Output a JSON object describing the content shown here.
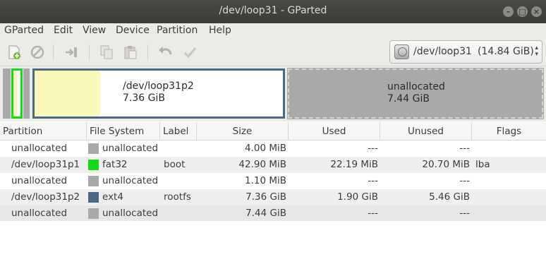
{
  "window": {
    "title": "/dev/loop31 - GParted"
  },
  "menu": {
    "items": [
      "GParted",
      "Edit",
      "View",
      "Device",
      "Partition",
      "Help"
    ]
  },
  "toolbar": {
    "device_path": "/dev/loop31",
    "device_size": "(14.84 GiB)"
  },
  "map": {
    "p2_name": "/dev/loop31p2",
    "p2_size": "7.36 GiB",
    "unalloc_name": "unallocated",
    "unalloc_size": "7.44 GiB"
  },
  "table": {
    "headers": [
      "Partition",
      "File System",
      "Label",
      "Size",
      "Used",
      "Unused",
      "Flags"
    ],
    "rows": [
      {
        "partition": "unallocated",
        "fs": "unallocated",
        "fs_color": "#a9a9a9",
        "label": "",
        "size": "4.00 MiB",
        "used": "---",
        "unused": "---",
        "flags": ""
      },
      {
        "partition": "/dev/loop31p1",
        "fs": "fat32",
        "fs_color": "#18d918",
        "label": "boot",
        "size": "42.90 MiB",
        "used": "22.19 MiB",
        "unused": "20.70 MiB",
        "flags": "lba"
      },
      {
        "partition": "unallocated",
        "fs": "unallocated",
        "fs_color": "#a9a9a9",
        "label": "",
        "size": "1.10 MiB",
        "used": "---",
        "unused": "---",
        "flags": ""
      },
      {
        "partition": "/dev/loop31p2",
        "fs": "ext4",
        "fs_color": "#4b6983",
        "label": "rootfs",
        "size": "7.36 GiB",
        "used": "1.90 GiB",
        "unused": "5.46 GiB",
        "flags": ""
      },
      {
        "partition": "unallocated",
        "fs": "unallocated",
        "fs_color": "#a9a9a9",
        "label": "",
        "size": "7.44 GiB",
        "used": "---",
        "unused": "---",
        "flags": ""
      }
    ]
  },
  "colors": {
    "fat32": "#18d918",
    "ext4": "#4b6983",
    "unallocated": "#a9a9a9",
    "used_fill": "#f8f8ba"
  }
}
